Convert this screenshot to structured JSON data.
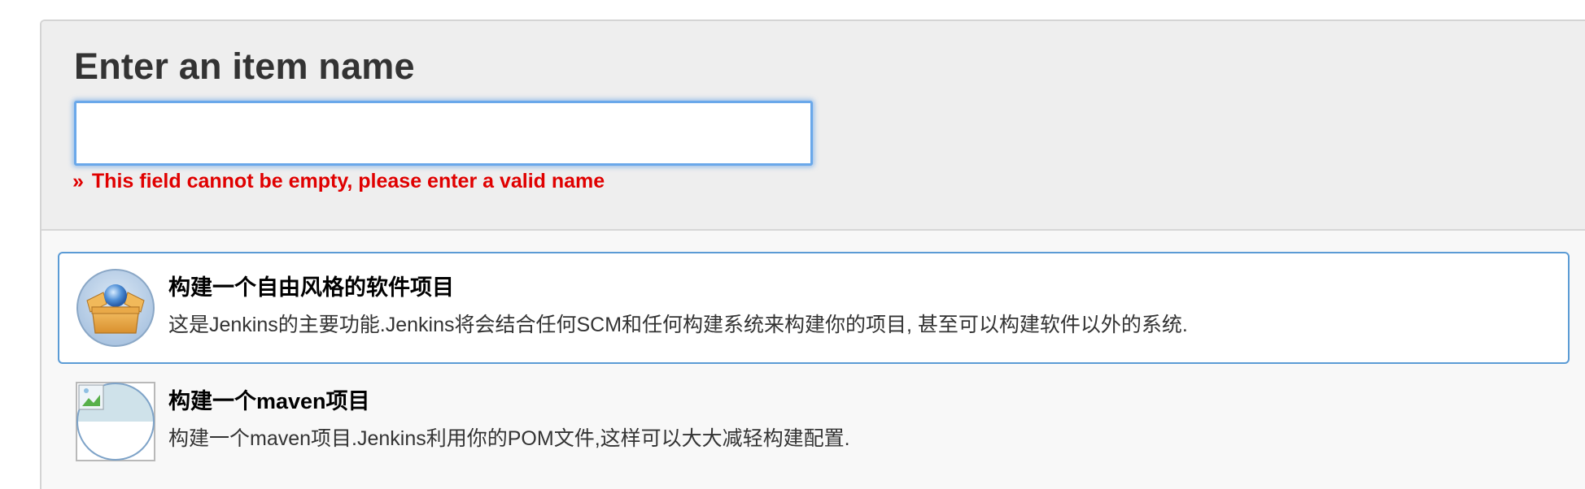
{
  "form": {
    "title": "Enter an item name",
    "input_value": "",
    "error_prefix": "»",
    "error_message": "This field cannot be empty, please enter a valid name"
  },
  "items": [
    {
      "name": "构建一个自由风格的软件项目",
      "description": "这是Jenkins的主要功能.Jenkins将会结合任何SCM和任何构建系统来构建你的项目, 甚至可以构建软件以外的系统.",
      "icon": "freestyle-box-icon",
      "selected": true
    },
    {
      "name": "构建一个maven项目",
      "description": "构建一个maven项目.Jenkins利用你的POM文件,这样可以大大减轻构建配置.",
      "icon": "broken-image-icon",
      "selected": false
    }
  ],
  "colors": {
    "error": "#e00000",
    "selected_border": "#5b9bd5",
    "input_focus": "#6aa8ea",
    "header_bg": "#eeeeee"
  }
}
